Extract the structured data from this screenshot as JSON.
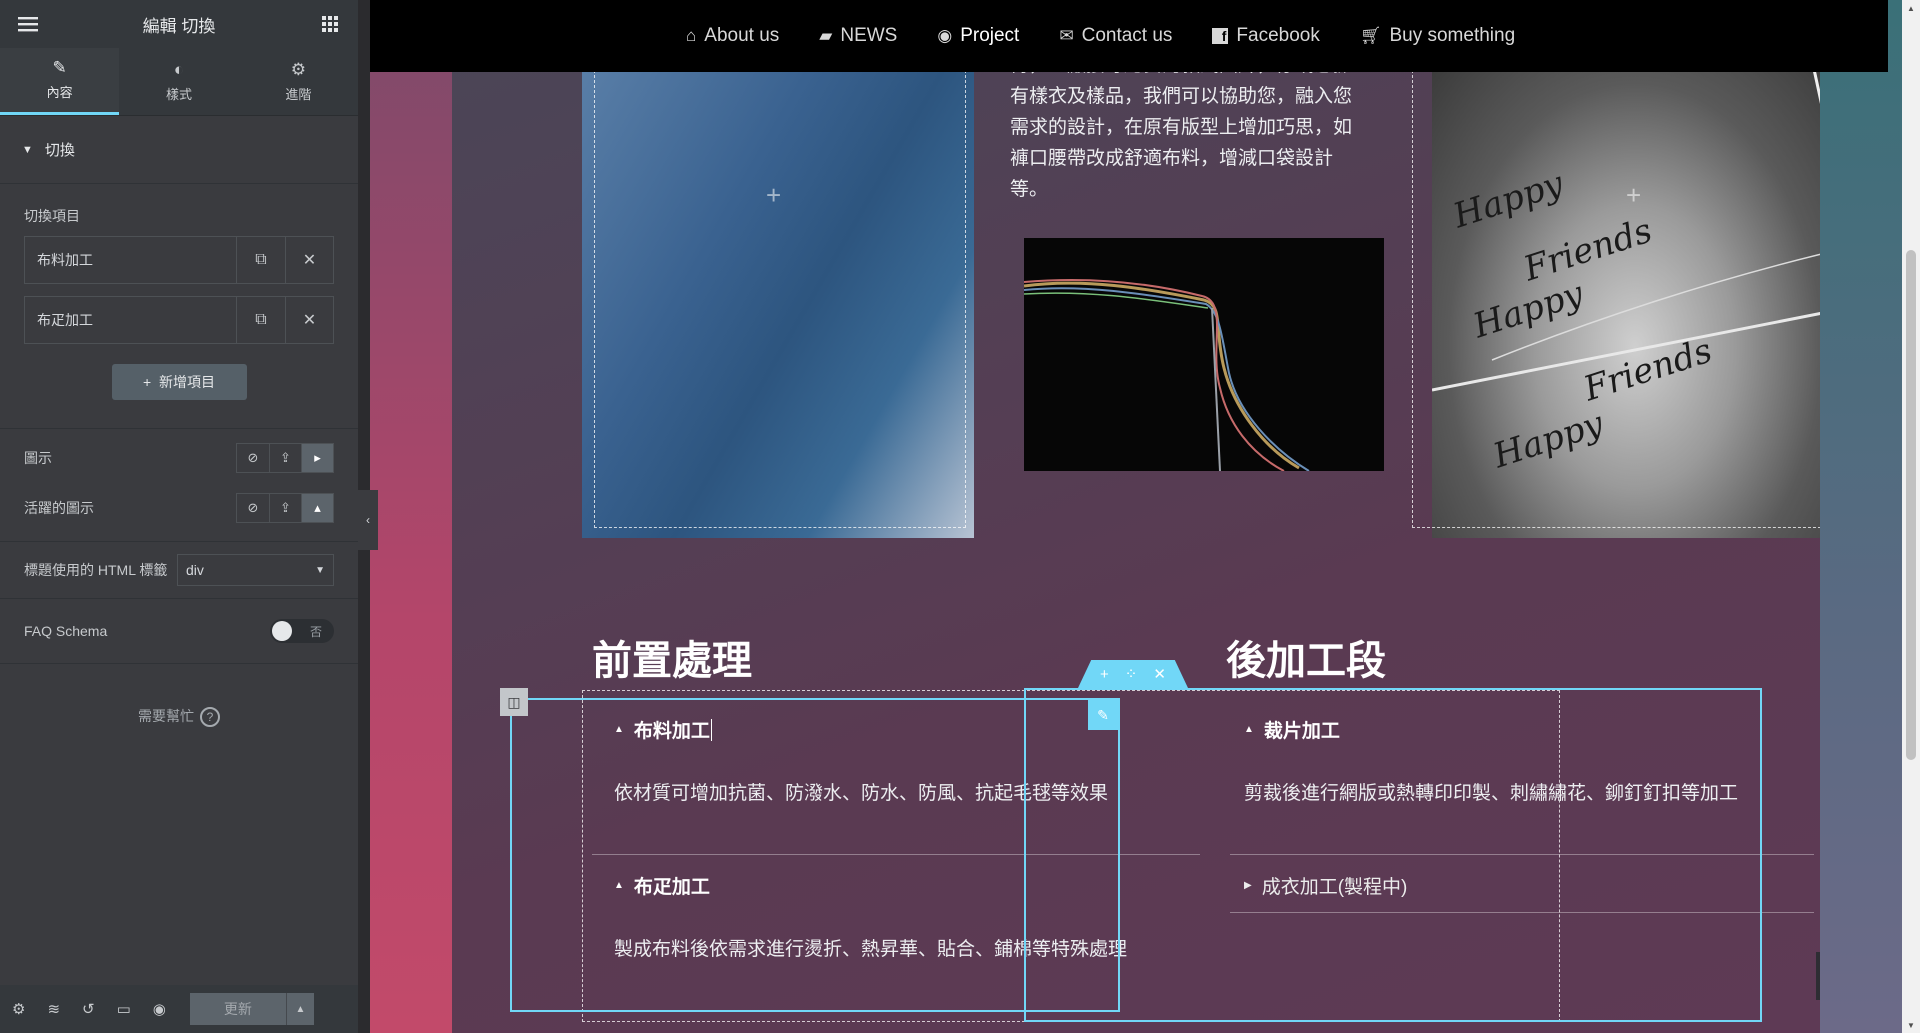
{
  "panel": {
    "title": "編輯 切換",
    "tabs": [
      {
        "label": "內容",
        "icon": "pencil-icon"
      },
      {
        "label": "樣式",
        "icon": "contrast-icon"
      },
      {
        "label": "進階",
        "icon": "gear-icon"
      }
    ],
    "section_title": "切換",
    "repeater_label": "切換項目",
    "items": [
      {
        "title": "布料加工"
      },
      {
        "title": "布疋加工"
      }
    ],
    "add_item": "新增項目",
    "icon_label": "圖示",
    "active_icon_label": "活躍的圖示",
    "html_tag_label": "標題使用的 HTML 標籤",
    "html_tag_value": "div",
    "faq_label": "FAQ Schema",
    "faq_toggle": "否",
    "help_text": "需要幫忙",
    "update_label": "更新"
  },
  "nav": [
    {
      "label": "About us",
      "icon": "home-icon"
    },
    {
      "label": "NEWS",
      "icon": "comment-icon"
    },
    {
      "label": "Project",
      "icon": "eye-icon"
    },
    {
      "label": "Contact us",
      "icon": "envelope-icon"
    },
    {
      "label": "Facebook",
      "icon": "facebook-icon"
    },
    {
      "label": "Buy something",
      "icon": "cart-icon"
    }
  ],
  "intro_lines": [
    "傳，工廠接等總安的款式圖片，亦或您擁",
    "有樣衣及樣品，我們可以協助您，融入您",
    "需求的設計，在原有版型上增加巧思，如",
    "褲口腰帶改成舒適布料，增減口袋設計",
    "等。"
  ],
  "photo_handwriting": [
    "Happy",
    "Friends",
    "Happy",
    "Friends",
    "Happy"
  ],
  "left_heading": "前置處理",
  "right_heading": "後加工段",
  "left_accordion": [
    {
      "title": "布料加工",
      "text": "依材質可增加抗菌、防潑水、防水、防風、抗起毛毬等效果"
    },
    {
      "title": "布疋加工",
      "text": "製成布料後依需求進行燙折、熱昇華、貼合、鋪棉等特殊處理"
    }
  ],
  "right_accordion": [
    {
      "title": "裁片加工",
      "text": "剪裁後進行網版或熱轉印印製、刺繡繡花、鉚釘釘扣等加工"
    },
    {
      "title": "成衣加工(製程中)"
    }
  ],
  "colors": {
    "accent": "#71d7f7",
    "panel_bg": "#3a3b3f",
    "nav_bg": "#000000"
  }
}
